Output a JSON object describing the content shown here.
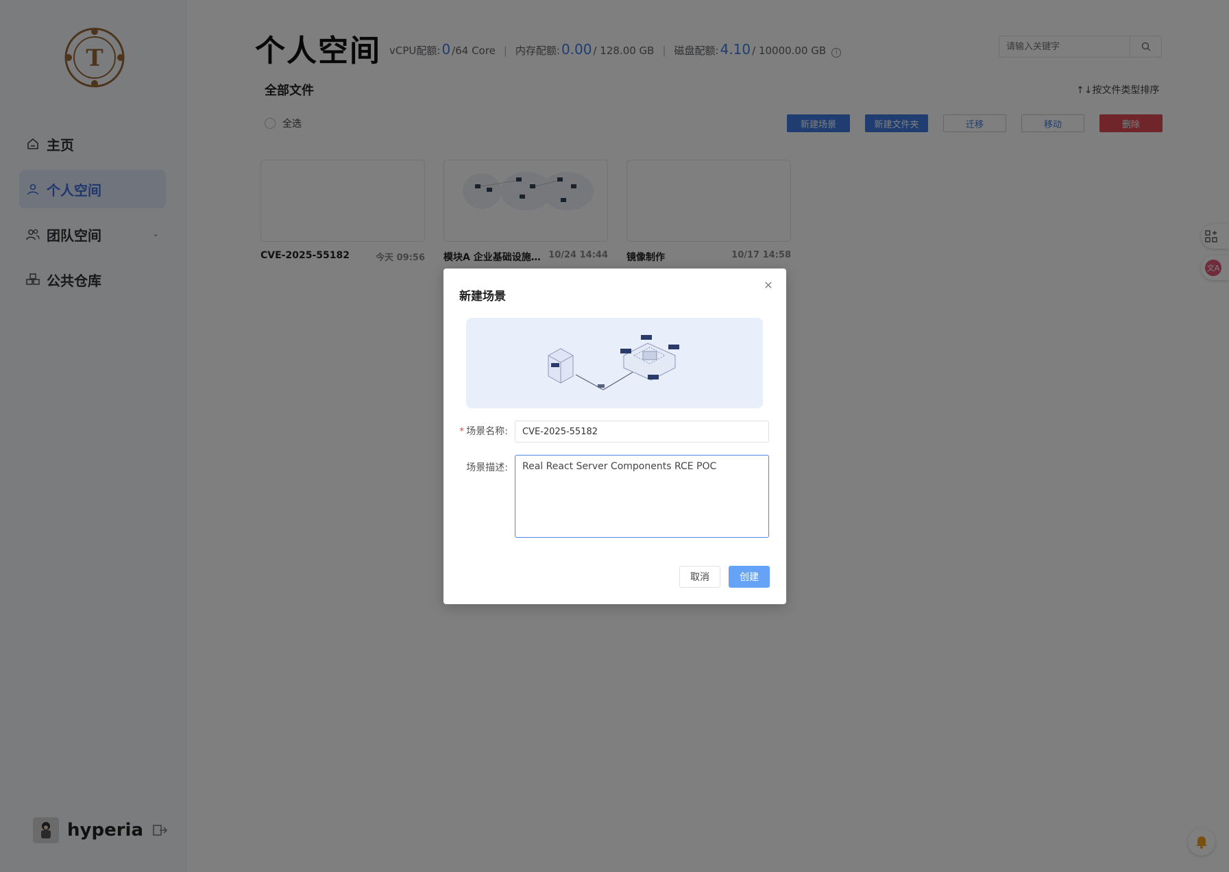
{
  "sidebar": {
    "logo_letter": "T",
    "items": [
      {
        "label": "主页",
        "icon": "home-icon",
        "active": false
      },
      {
        "label": "个人空间",
        "icon": "user-icon",
        "active": true
      },
      {
        "label": "团队空间",
        "icon": "team-icon",
        "active": false
      },
      {
        "label": "公共仓库",
        "icon": "cubes-icon",
        "active": false
      }
    ],
    "user_name": "hyperia"
  },
  "header": {
    "title": "个人空间",
    "vcpu_label": "vCPU配额:",
    "vcpu_used": "0",
    "vcpu_total": "/64 Core",
    "mem_label": "内存配额:",
    "mem_used": "0.00",
    "mem_total": "/ 128.00 GB",
    "disk_label": "磁盘配额:",
    "disk_used": "4.10",
    "disk_total": "/ 10000.00 GB",
    "search_placeholder": "请输入关键字"
  },
  "files": {
    "section_title": "全部文件",
    "sort_label": "↑↓按文件类型排序",
    "select_all": "全选",
    "actions": {
      "new_scene": "新建场景",
      "new_folder": "新建文件夹",
      "migrate": "迁移",
      "move": "移动",
      "delete": "删除"
    },
    "cards": [
      {
        "name": "CVE-2025-55182",
        "time": "今天 09:56"
      },
      {
        "name": "模块A 企业基础设施安...",
        "time": "10/24 14:44"
      },
      {
        "name": "镜像制作",
        "time": "10/17 14:58"
      }
    ]
  },
  "modal": {
    "title": "新建场景",
    "name_label": "场景名称:",
    "name_value": "CVE-2025-55182",
    "desc_label": "场景描述:",
    "desc_value": "Real React Server Components RCE POC",
    "cancel": "取消",
    "create": "创建"
  },
  "colors": {
    "accent": "#3f7be0",
    "danger": "#e04a55",
    "active_nav_bg": "#dfe8fb"
  }
}
